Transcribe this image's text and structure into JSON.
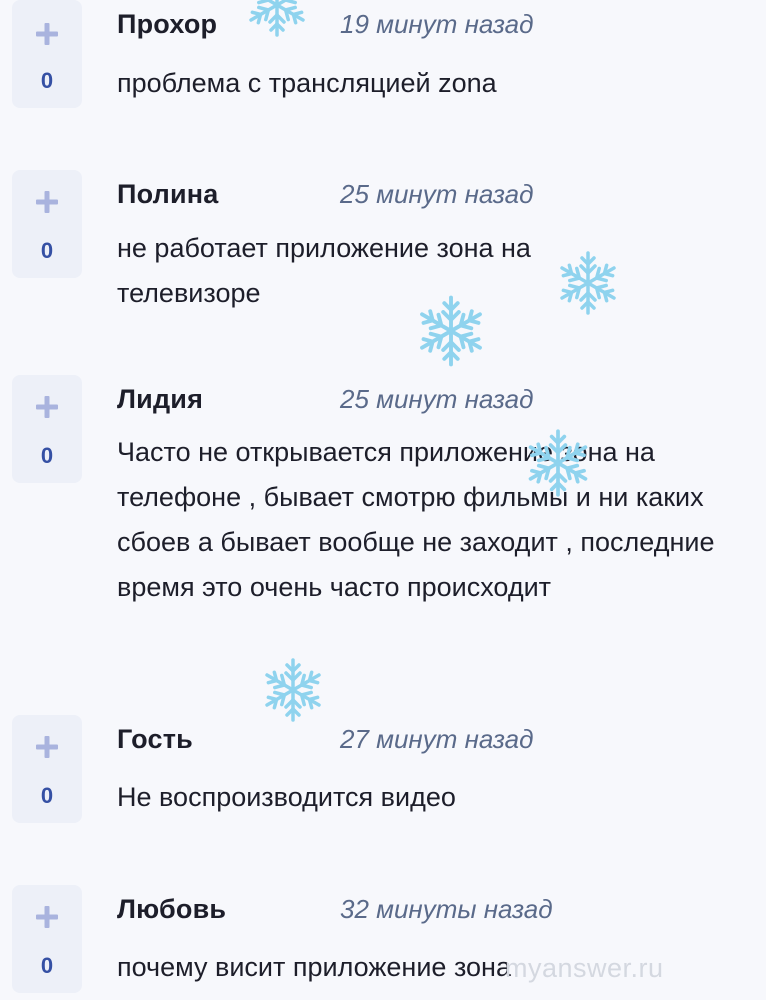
{
  "comments": [
    {
      "author": "Прохор",
      "time": "19 минут назад",
      "votes": "0",
      "text": "проблема с трансляцией zona"
    },
    {
      "author": "Полина",
      "time": "25 минут назад",
      "votes": "0",
      "text": "не работает приложение зона на телевизоре"
    },
    {
      "author": "Лидия",
      "time": "25 минут назад",
      "votes": "0",
      "text": "Часто не открывается приложение зона на телефоне , бывает смотрю фильмы и ни каких сбоев а бывает вообще не заходит , последние время это очень часто происходит"
    },
    {
      "author": "Гость",
      "time": "27 минут назад",
      "votes": "0",
      "text": "Не воспроизводится видео"
    },
    {
      "author": "Любовь",
      "time": "32 минуты назад",
      "votes": "0",
      "text": "почему висит приложение зона"
    }
  ],
  "icons": {
    "vote": "plus-icon",
    "decoration": "snowflake-icon"
  },
  "colors": {
    "background": "#f7f8fc",
    "vote_box": "#edf0f8",
    "vote_plus": "#a9b3de",
    "vote_count": "#3550a4",
    "timestamp": "#5a6a8a",
    "snowflake": "#8fd3ee"
  },
  "watermark": "myanswer.ru"
}
